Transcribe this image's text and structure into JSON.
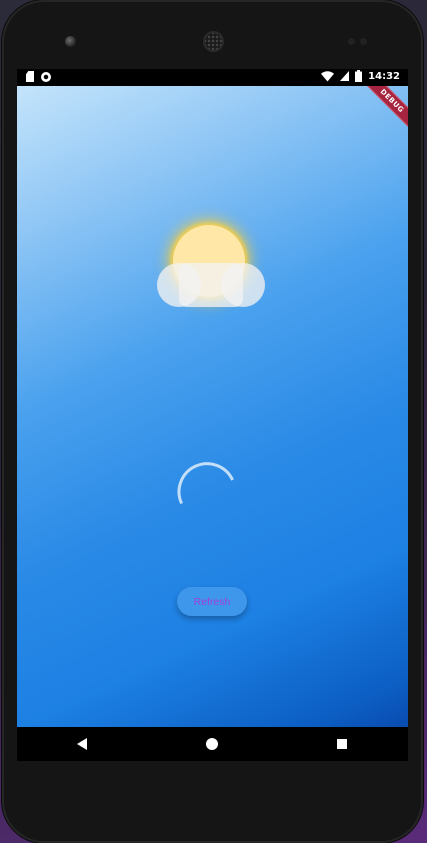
{
  "status_bar": {
    "time": "14:32",
    "left_icons": [
      "sd-card-icon",
      "sync-circle-icon"
    ],
    "right_icons": [
      "wifi-icon",
      "cellular-signal-icon",
      "battery-icon"
    ]
  },
  "debug_banner": "DEBUG",
  "main": {
    "weather_icon": "sun-behind-cloud-icon",
    "loading_indicator": "circular-progress-icon",
    "refresh_label": "Refresh"
  },
  "nav_bar": {
    "buttons": [
      "back-icon",
      "home-icon",
      "recents-icon"
    ]
  },
  "colors": {
    "gradient_top_left": "#c4e4fb",
    "gradient_bottom_right": "#0a4bb0",
    "sun": "#ffe7a8",
    "sun_glow": "#f7cd3c",
    "button_background": "#3f97ec",
    "button_text": "#a03fd8",
    "debug_banner": "#a6243f"
  }
}
